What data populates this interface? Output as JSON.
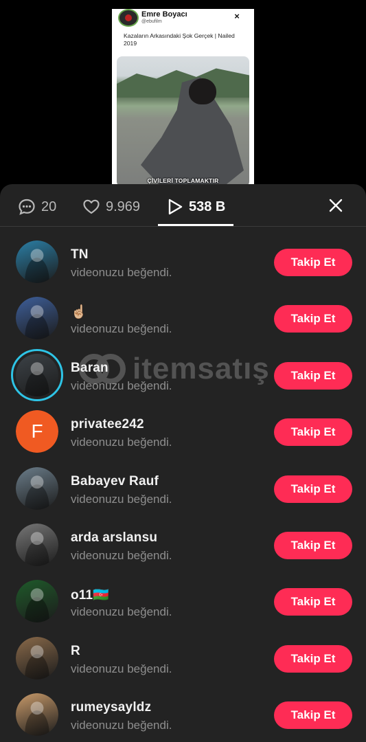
{
  "preview": {
    "author_name": "Emre Boyacı",
    "author_handle": "@ebufilm",
    "close_glyph": "×",
    "caption": "Kazaların Arkasındaki Şok Gerçek | Nailed 2019",
    "subtitle": "ÇİVİLERİ TOPLAMAKTIR"
  },
  "tabs": {
    "comments_count": "20",
    "likes_count": "9.969",
    "views_count": "538 B",
    "active": "views"
  },
  "watermark": {
    "text": "itemsatış"
  },
  "list": {
    "action_label": "Takip Et",
    "items": [
      {
        "name": "TN",
        "subtitle": "videonuzu beğendi.",
        "avatar": "photo-pool",
        "avatar_color": "#2b7fa6"
      },
      {
        "name": "☝🏼",
        "subtitle": "videonuzu beğendi.",
        "avatar": "photo-people-blue",
        "avatar_color": "#3e5f9a"
      },
      {
        "name": "Baran",
        "subtitle": "videonuzu beğendi.",
        "avatar": "photo-car-interior",
        "avatar_color": "#3c4247",
        "story_ring": true
      },
      {
        "name": "privatee242",
        "subtitle": "videonuzu beğendi.",
        "avatar": "letter",
        "avatar_letter": "F",
        "avatar_color": "#f05a22"
      },
      {
        "name": "Babayev Rauf",
        "subtitle": "videonuzu beğendi.",
        "avatar": "photo-street-man",
        "avatar_color": "#6b7d8a"
      },
      {
        "name": "arda arslansu",
        "subtitle": "videonuzu beğendi.",
        "avatar": "photo-bw-portrait",
        "avatar_color": "#777777"
      },
      {
        "name": "o11🇦🇿",
        "subtitle": "videonuzu beğendi.",
        "avatar": "emblem-car",
        "avatar_color": "#1f5a2a"
      },
      {
        "name": "R",
        "subtitle": "videonuzu beğendi.",
        "avatar": "photo-two-people",
        "avatar_color": "#8a6a4a"
      },
      {
        "name": "rumeysayldz",
        "subtitle": "videonuzu beğendi.",
        "avatar": "photo-selfie",
        "avatar_color": "#c89a6a"
      }
    ]
  },
  "icons": {
    "comment": "comment-bubble-icon",
    "like": "heart-icon",
    "views": "play-icon",
    "close": "close-icon"
  },
  "colors": {
    "sheet_bg": "#232323",
    "follow_button": "#fe2c55",
    "story_ring": "#2ec4e6"
  }
}
